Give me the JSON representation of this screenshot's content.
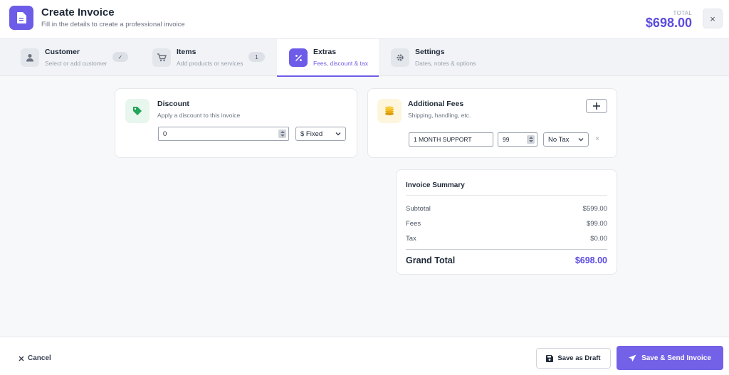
{
  "header": {
    "title": "Create Invoice",
    "subtitle": "Fill in the details to create a professional invoice",
    "total_label": "TOTAL",
    "total_value": "$698.00",
    "close_label": "×"
  },
  "tabs": [
    {
      "label": "Customer",
      "desc": "Select or add customer",
      "badge": "✓",
      "icon": "user-icon"
    },
    {
      "label": "Items",
      "desc": "Add products or services",
      "badge": "1",
      "icon": "cart-icon"
    },
    {
      "label": "Extras",
      "desc": "Fees, discount & tax",
      "icon": "percent-icon",
      "active": true
    },
    {
      "label": "Settings",
      "desc": "Dates, notes & options",
      "icon": "gear-icon"
    }
  ],
  "discount": {
    "title": "Discount",
    "desc": "Apply a discount to this invoice",
    "value": "0",
    "type_selected": "$ Fixed",
    "icon": "tag-icon"
  },
  "fees": {
    "title": "Additional Fees",
    "desc": "Shipping, handling, etc.",
    "icon": "coins-icon",
    "add_label": "+",
    "item": {
      "name": "1 MONTH SUPPORT",
      "amount": "99",
      "tax_selected": "No Tax",
      "remove_label": "×"
    }
  },
  "summary": {
    "title": "Invoice Summary",
    "rows": [
      {
        "label": "Subtotal",
        "value": "$599.00"
      },
      {
        "label": "Fees",
        "value": "$99.00"
      },
      {
        "label": "Tax",
        "value": "$0.00"
      }
    ],
    "grand_label": "Grand Total",
    "grand_value": "$698.00"
  },
  "footer": {
    "cancel_label": "Cancel",
    "draft_label": "Save as Draft",
    "send_label": "Save & Send Invoice"
  },
  "colors": {
    "accent": "#6d5ce7",
    "total": "#5b4ce0",
    "discount_icon_bg": "#e8f7ee",
    "fees_icon_bg": "#fdf6dc"
  }
}
